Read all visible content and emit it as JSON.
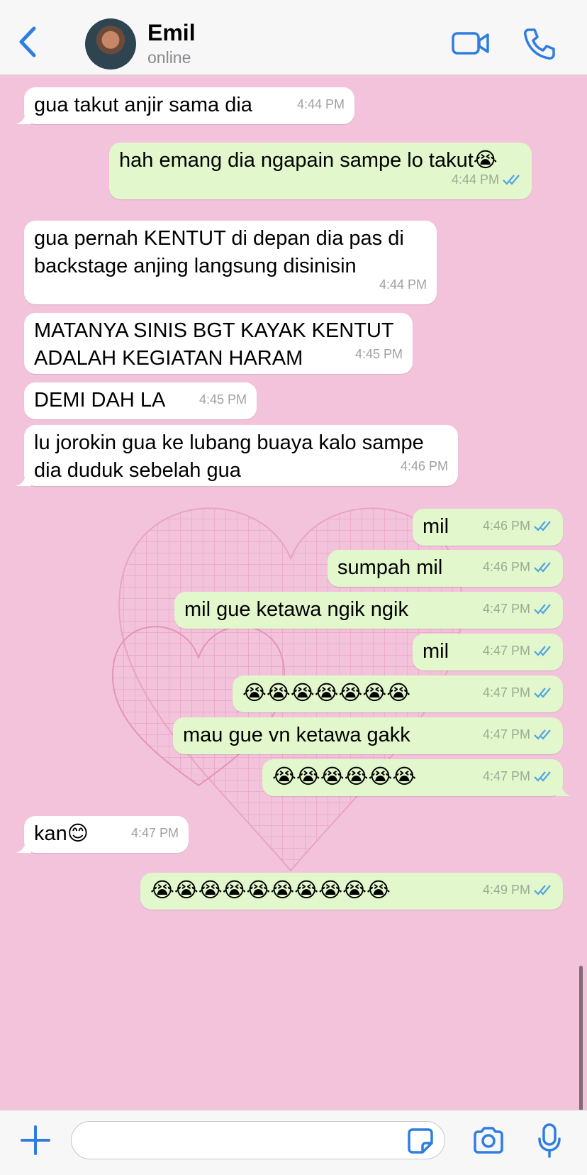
{
  "header": {
    "contact_name": "Emil",
    "status": "online",
    "accent_color": "#2f7de1"
  },
  "messages": [
    {
      "dir": "in",
      "text": "gua takut anjir sama dia",
      "time": "4:44 PM"
    },
    {
      "dir": "out",
      "text": "hah emang dia ngapain sampe lo takut😭",
      "time": "4:44 PM",
      "status": "read"
    },
    {
      "dir": "in",
      "text": "gua pernah KENTUT di depan dia pas di backstage anjing langsung disinisin",
      "time": "4:44 PM"
    },
    {
      "dir": "in",
      "text": "MATANYA SINIS BGT KAYAK KENTUT ADALAH KEGIATAN HARAM",
      "time": "4:45 PM"
    },
    {
      "dir": "in",
      "text": "DEMI DAH LA",
      "time": "4:45 PM"
    },
    {
      "dir": "in",
      "text": "lu jorokin gua ke lubang buaya kalo sampe dia duduk sebelah gua",
      "time": "4:46 PM"
    },
    {
      "dir": "out",
      "text": "mil",
      "time": "4:46 PM",
      "status": "read"
    },
    {
      "dir": "out",
      "text": "sumpah mil",
      "time": "4:46 PM",
      "status": "read"
    },
    {
      "dir": "out",
      "text": "mil gue ketawa ngik ngik",
      "time": "4:47 PM",
      "status": "read"
    },
    {
      "dir": "out",
      "text": "mil",
      "time": "4:47 PM",
      "status": "read"
    },
    {
      "dir": "out",
      "text": "😭😭😭😭😭😭😭",
      "time": "4:47 PM",
      "status": "read"
    },
    {
      "dir": "out",
      "text": "mau gue vn ketawa gakk",
      "time": "4:47 PM",
      "status": "read"
    },
    {
      "dir": "out",
      "text": "😭😭😭😭😭😭",
      "time": "4:47 PM",
      "status": "read"
    },
    {
      "dir": "in",
      "text": "kan😊",
      "time": "4:47 PM"
    },
    {
      "dir": "out",
      "text": "😭😭😭😭😭😭😭😭😭😭",
      "time": "4:49 PM",
      "status": "read"
    }
  ],
  "composer": {
    "value": "",
    "placeholder": ""
  },
  "icons": {
    "back": "chevron-left-icon",
    "video": "video-camera-icon",
    "call": "phone-icon",
    "plus": "plus-icon",
    "sticker": "sticker-icon",
    "camera": "camera-icon",
    "mic": "microphone-icon"
  },
  "colors": {
    "wallpaper": "#f3c3dc",
    "incoming_bubble": "#ffffff",
    "outgoing_bubble": "#e2f7cb",
    "read_ticks": "#4fa3e8"
  }
}
